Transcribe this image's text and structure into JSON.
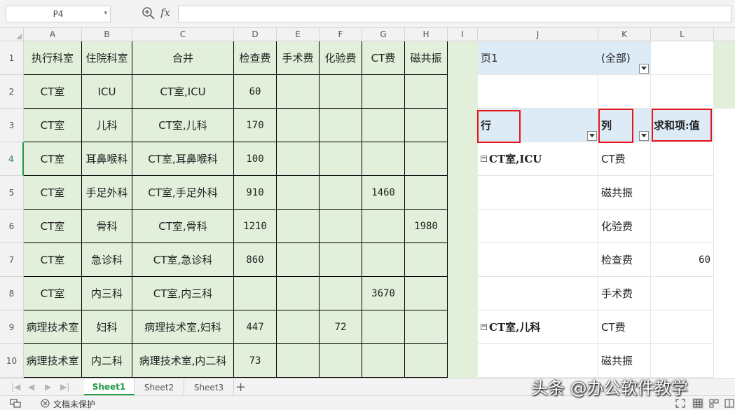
{
  "formula_bar": {
    "name_box": "P4",
    "fx": "fx",
    "formula": ""
  },
  "columns": [
    "A",
    "B",
    "C",
    "D",
    "E",
    "F",
    "G",
    "H",
    "I",
    "J",
    "K",
    "L"
  ],
  "rows": [
    "1",
    "2",
    "3",
    "4",
    "5",
    "6",
    "7",
    "8",
    "9",
    "10"
  ],
  "table_headers": [
    "执行科室",
    "住院科室",
    "合并",
    "检查费",
    "手术费",
    "化验费",
    "CT费",
    "磁共振"
  ],
  "table_rows": [
    [
      "CT室",
      "ICU",
      "CT室,ICU",
      "60",
      "",
      "",
      "",
      ""
    ],
    [
      "CT室",
      "儿科",
      "CT室,儿科",
      "170",
      "",
      "",
      "",
      ""
    ],
    [
      "CT室",
      "耳鼻喉科",
      "CT室,耳鼻喉科",
      "100",
      "",
      "",
      "",
      ""
    ],
    [
      "CT室",
      "手足外科",
      "CT室,手足外科",
      "910",
      "",
      "",
      "1460",
      ""
    ],
    [
      "CT室",
      "骨科",
      "CT室,骨科",
      "1210",
      "",
      "",
      "",
      "1980"
    ],
    [
      "CT室",
      "急诊科",
      "CT室,急诊科",
      "860",
      "",
      "",
      "",
      ""
    ],
    [
      "CT室",
      "内三科",
      "CT室,内三科",
      "",
      "",
      "",
      "3670",
      ""
    ],
    [
      "病理技术室",
      "妇科",
      "病理技术室,妇科",
      "447",
      "",
      "72",
      "",
      ""
    ],
    [
      "病理技术室",
      "内二科",
      "病理技术室,内二科",
      "73",
      "",
      "",
      "",
      ""
    ]
  ],
  "pivot": {
    "page_field": "页1",
    "page_value": "(全部)",
    "row_header": "行",
    "col_header": "列",
    "value_header": "求和项:值",
    "rows": [
      {
        "row": "CT室,ICU",
        "col": "CT费",
        "value": ""
      },
      {
        "row": "",
        "col": "磁共振",
        "value": ""
      },
      {
        "row": "",
        "col": "化验费",
        "value": ""
      },
      {
        "row": "",
        "col": "检查费",
        "value": "60"
      },
      {
        "row": "",
        "col": "手术费",
        "value": ""
      },
      {
        "row": "CT室,儿科",
        "col": "CT费",
        "value": ""
      },
      {
        "row": "",
        "col": "磁共振",
        "value": ""
      }
    ]
  },
  "sheet_tabs": [
    "Sheet1",
    "Sheet2",
    "Sheet3"
  ],
  "active_sheet": "Sheet1",
  "status": {
    "protection": "文档未保护"
  },
  "watermark": "头条 @办公软件教学",
  "colors": {
    "data_fill": "#e2efda",
    "pivot_header_fill": "#ddebf7",
    "highlight": "#e8161b",
    "accent": "#1f9a45"
  }
}
